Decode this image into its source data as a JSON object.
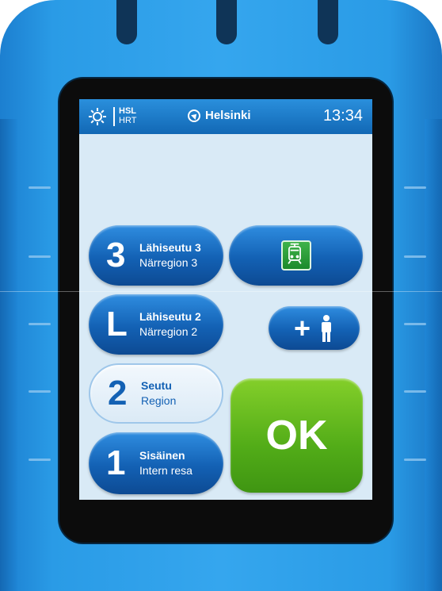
{
  "status_bar": {
    "logo_line1": "HSL",
    "logo_line2": "HRT",
    "location": "Helsinki",
    "time": "13:34"
  },
  "zones": [
    {
      "number": "3",
      "title": "Lähiseutu 3",
      "subtitle": "Närregion 3"
    },
    {
      "number": "L",
      "title": "Lähiseutu 2",
      "subtitle": "Närregion 2"
    },
    {
      "number": "2",
      "title": "Seutu",
      "subtitle": "Region"
    },
    {
      "number": "1",
      "title": "Sisäinen",
      "subtitle": "Intern resa"
    }
  ],
  "ok_label": "OK",
  "add_label": "+",
  "colors": {
    "device_blue": "#2a9be6",
    "button_blue": "#1361b4",
    "ok_green": "#6cbf22",
    "tram_green": "#2c9f3a"
  },
  "icons": [
    "settings-gear-icon",
    "location-arrow-icon",
    "tram-icon",
    "person-icon"
  ]
}
